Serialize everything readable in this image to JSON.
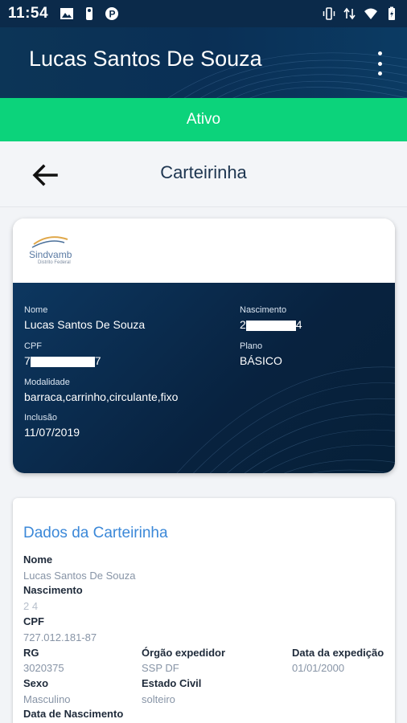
{
  "status_bar": {
    "time": "11:54",
    "left_icons": [
      "image-icon",
      "person-icon",
      "parking-icon"
    ],
    "right_icons": [
      "vibrate-icon",
      "data-arrows-icon",
      "wifi-icon",
      "battery-icon"
    ]
  },
  "header": {
    "title": "Lucas Santos De Souza",
    "menu_icon": "more-vert-icon"
  },
  "status": {
    "label": "Ativo",
    "color": "#0cd37b"
  },
  "nav": {
    "back_icon": "arrow-back-icon",
    "title": "Carteirinha"
  },
  "card": {
    "logo_text": "Sindvamb",
    "logo_sub": "Distrito Federal",
    "nome_label": "Nome",
    "nome_value": "Lucas Santos De Souza",
    "nascimento_label": "Nascimento",
    "nascimento_prefix": "2",
    "nascimento_suffix": "4",
    "cpf_label": "CPF",
    "cpf_prefix": "7",
    "cpf_suffix": "7",
    "plano_label": "Plano",
    "plano_value": "BÁSICO",
    "modalidade_label": "Modalidade",
    "modalidade_value": "barraca,carrinho,circulante,fixo",
    "inclusao_label": "Inclusão",
    "inclusao_value": "11/07/2019"
  },
  "details": {
    "title": "Dados da Carteirinha",
    "nome_label": "Nome",
    "nome_value": "Lucas Santos De Souza",
    "nascimento_label": "Nascimento",
    "nascimento_value": "2 4",
    "cpf_label": "CPF",
    "cpf_value": "727.012.181-87",
    "rg_label": "RG",
    "rg_value": "3020375",
    "orgao_label": "Órgão expedidor",
    "orgao_value": "SSP DF",
    "data_expedicao_label": "Data da expedição",
    "data_expedicao_value": "01/01/2000",
    "sexo_label": "Sexo",
    "sexo_value": "Masculino",
    "estado_civil_label": "Estado Civil",
    "estado_civil_value": "solteiro",
    "data_nascimento_label": "Data de Nascimento"
  }
}
